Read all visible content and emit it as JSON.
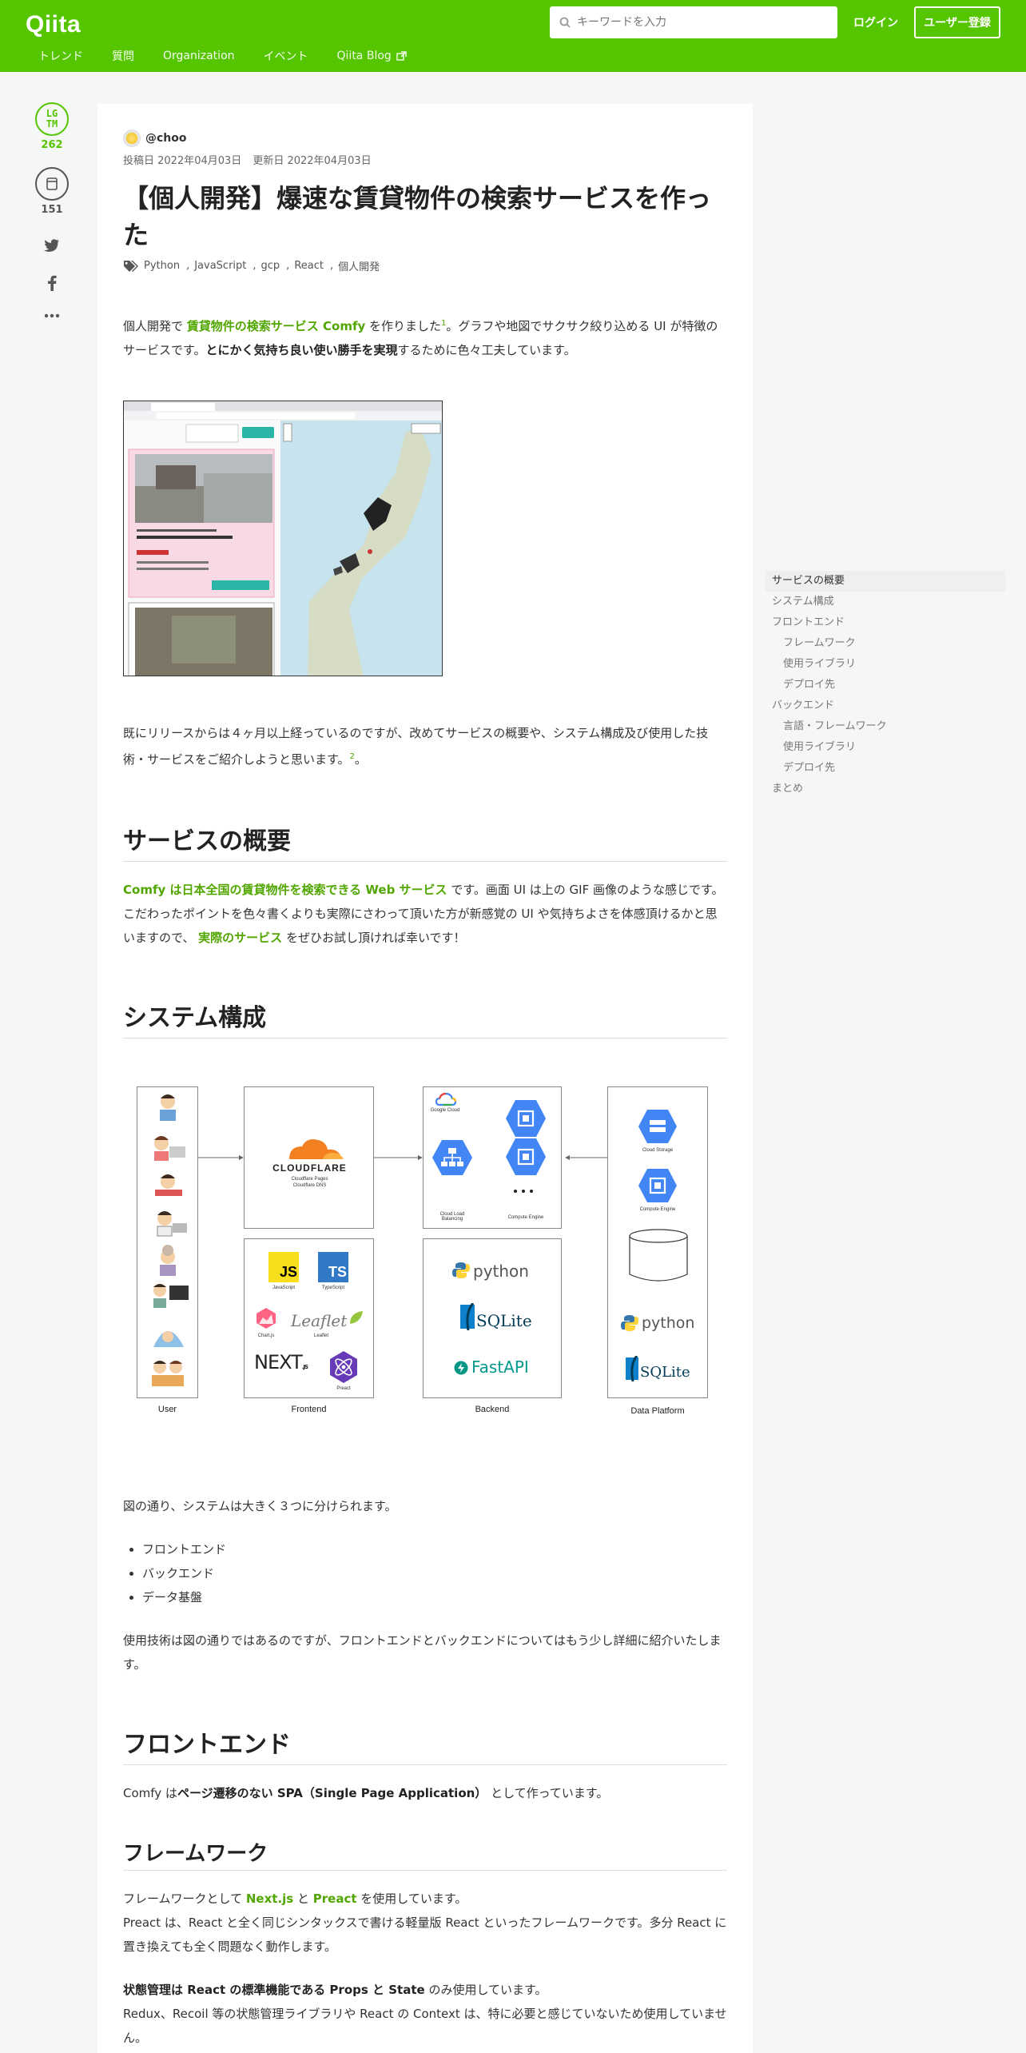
{
  "header": {
    "logo": "Qiita",
    "search_placeholder": "キーワードを入力",
    "login": "ログイン",
    "signup": "ユーザー登録",
    "nav": [
      "トレンド",
      "質問",
      "Organization",
      "イベント",
      "Qiita Blog"
    ]
  },
  "side": {
    "lgtm_label_1": "LG",
    "lgtm_label_2": "TM",
    "lgtm_count": "262",
    "stock_count": "151"
  },
  "article": {
    "author": "@choo",
    "posted": "投稿日 2022年04月03日",
    "updated": "更新日 2022年04月03日",
    "title": "【個人開発】爆速な賃貸物件の検索サービスを作った",
    "tags": [
      "Python",
      "JavaScript",
      "gcp",
      "React",
      "個人開発"
    ],
    "intro": {
      "p1_a": "個人開発で ",
      "p1_link": "賃貸物件の検索サービス Comfy",
      "p1_b": " を作りました",
      "p1_sup": "1",
      "p1_c": "。グラフや地図でサクサク絞り込める UI が特徴のサービスです。",
      "p1_bold": "とにかく気持ち良い使い勝手を実現",
      "p1_d": "するために色々工夫しています。"
    },
    "release": {
      "text": "既にリリースからは４ヶ月以上経っているのですが、改めてサービスの概要や、システム構成及び使用した技術・サービスをご紹介しようと思います。",
      "sup": "2",
      "end": "。"
    },
    "overview": {
      "heading": "サービスの概要",
      "link1": "Comfy は日本全国の賃貸物件を検索できる Web サービス",
      "t1": " です。画面 UI は上の GIF 画像のような感じです。",
      "t2": "こだわったポイントを色々書くよりも実際にさわって頂いた方が新感覚の UI や気持ちよさを体感頂けるかと思いますので、 ",
      "link2": "実際のサービス",
      "t3": " をぜひお試し頂ければ幸いです！"
    },
    "system": {
      "heading": "システム構成",
      "after": "図の通り、システムは大きく３つに分けられます。",
      "list": [
        "フロントエンド",
        "バックエンド",
        "データ基盤"
      ],
      "detail": "使用技術は図の通りではあるのですが、フロントエンドとバックエンドについてはもう少し詳細に紹介いたします。"
    },
    "diagram": {
      "user": "User",
      "frontend": "Frontend",
      "backend": "Backend",
      "platform": "Data Platform",
      "cloudflare": "CLOUDFLARE",
      "cf_sub1": "Cloudflare Pages",
      "cf_sub2": "Cloudflare DNS",
      "gc": "Google Cloud",
      "clb": "Cloud Load Balancing",
      "ce": "Compute Engine",
      "cs": "Cloud Storage",
      "ce2": "Compute Engine",
      "js": "JS",
      "js_cap": "JavaScript",
      "ts": "TS",
      "ts_cap": "TypeScript",
      "chart_cap": "Chart.js",
      "leaflet": "Leaflet",
      "leaflet_cap": "Leaflet",
      "next": "NEXT",
      "next_sub": ".JS",
      "preact_cap": "Preact",
      "python": "python",
      "sqlite": "SQLite",
      "fastapi": "FastAPI"
    },
    "frontend": {
      "heading": "フロントエンド",
      "t1": "Comfy は",
      "bold": "ページ遷移のない SPA（Single Page Application）",
      "t2": " として作っています。"
    },
    "framework": {
      "heading": "フレームワーク",
      "t1": "フレームワークとして ",
      "link1": "Next.js",
      "and": " と ",
      "link2": "Preact",
      "t2": " を使用しています。",
      "p2": "Preact は、React と全く同じシンタックスで書ける軽量版 React といったフレームワークです。多分 React に置き換えても全く問題なく動作します。",
      "bold3": "状態管理は React の標準機能である Props と State",
      "t3": " のみ使用しています。",
      "p4": "Redux、Recoil 等の状態管理ライブラリや React の Context は、特に必要と感じていないため使用していません。"
    }
  },
  "toc": [
    {
      "label": "サービスの概要",
      "level": 2,
      "active": true
    },
    {
      "label": "システム構成",
      "level": 2
    },
    {
      "label": "フロントエンド",
      "level": 2
    },
    {
      "label": "フレームワーク",
      "level": 3
    },
    {
      "label": "使用ライブラリ",
      "level": 3
    },
    {
      "label": "デプロイ先",
      "level": 3
    },
    {
      "label": "バックエンド",
      "level": 2
    },
    {
      "label": "言語・フレームワーク",
      "level": 3
    },
    {
      "label": "使用ライブラリ",
      "level": 3
    },
    {
      "label": "デプロイ先",
      "level": 3
    },
    {
      "label": "まとめ",
      "level": 2
    }
  ],
  "colors": {
    "brand": "#55c500",
    "link": "#51a600",
    "gcp_blue": "#4285f4",
    "cloudflare_orange": "#f38020"
  }
}
